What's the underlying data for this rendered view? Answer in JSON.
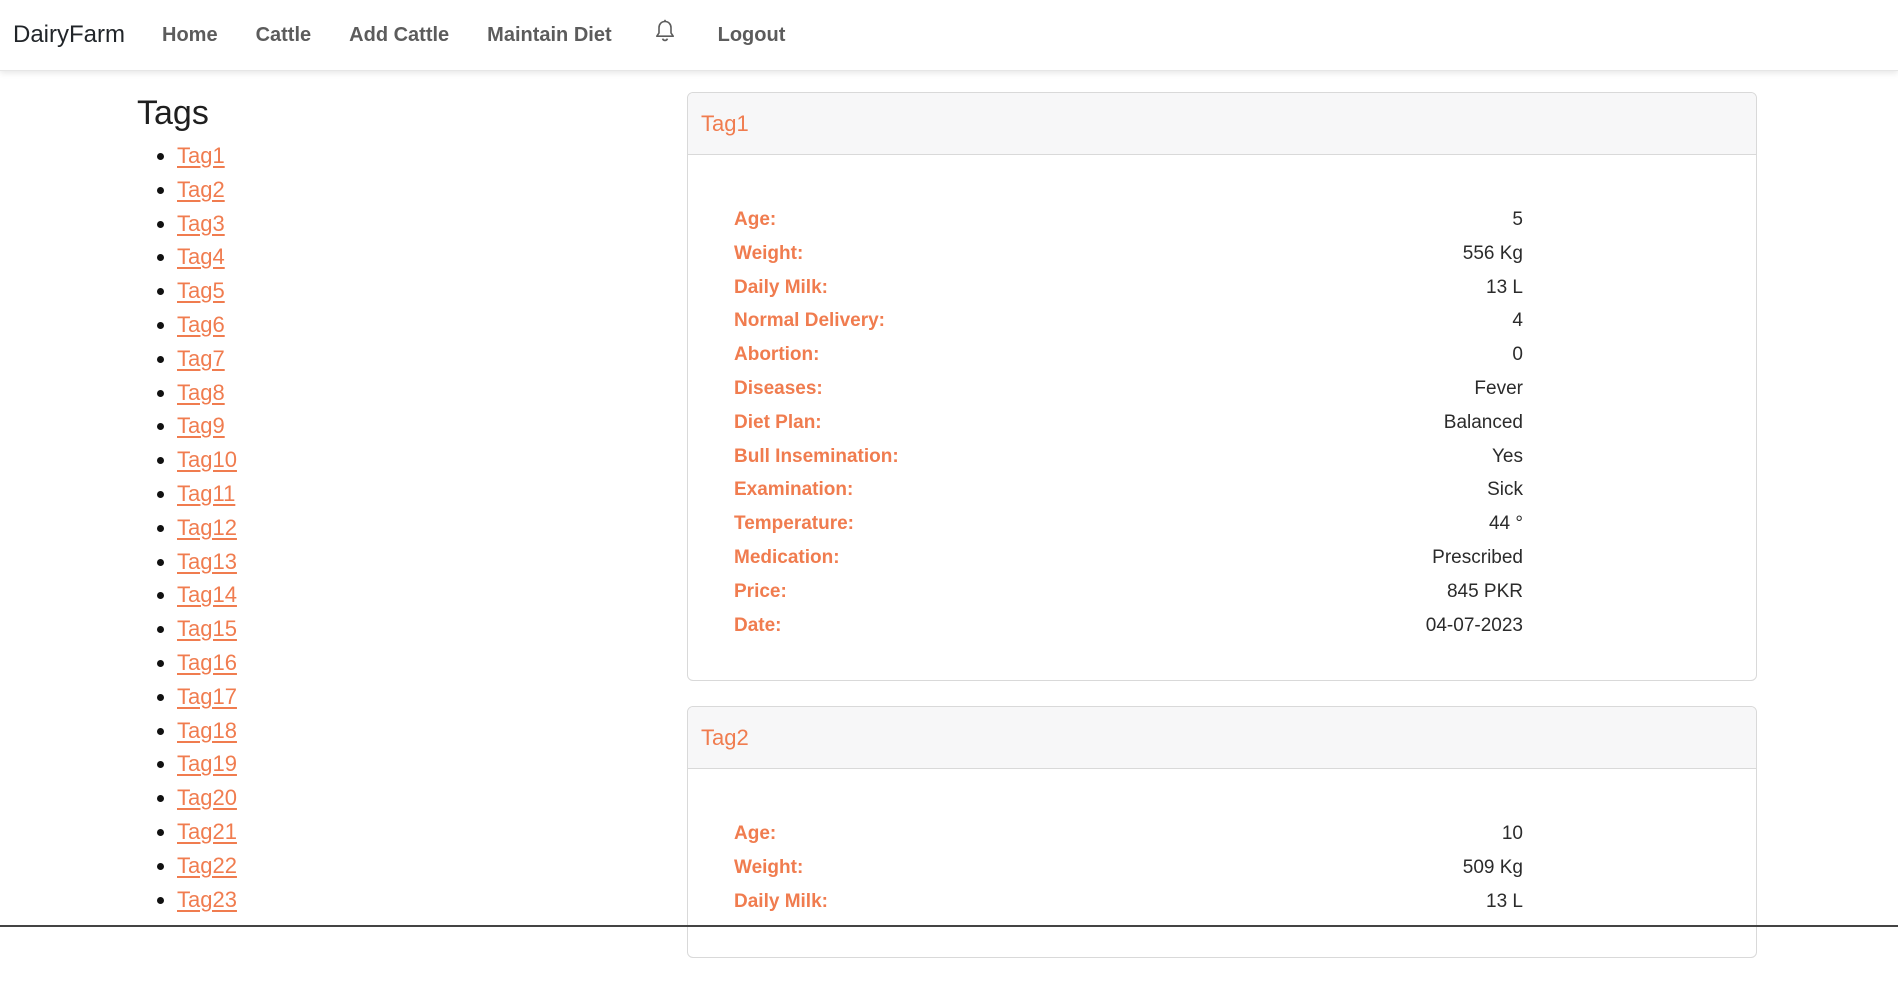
{
  "navbar": {
    "brand": "DairyFarm",
    "links": [
      "Home",
      "Cattle",
      "Add Cattle",
      "Maintain Diet"
    ],
    "logout": "Logout"
  },
  "sidebar": {
    "title": "Tags",
    "tags": [
      "Tag1",
      "Tag2",
      "Tag3",
      "Tag4",
      "Tag5",
      "Tag6",
      "Tag7",
      "Tag8",
      "Tag9",
      "Tag10",
      "Tag11",
      "Tag12",
      "Tag13",
      "Tag14",
      "Tag15",
      "Tag16",
      "Tag17",
      "Tag18",
      "Tag19",
      "Tag20",
      "Tag21",
      "Tag22",
      "Tag23"
    ]
  },
  "cards": [
    {
      "title": "Tag1",
      "fields": [
        {
          "label": "Age:",
          "value": "5"
        },
        {
          "label": "Weight:",
          "value": "556 Kg"
        },
        {
          "label": "Daily Milk:",
          "value": "13 L"
        },
        {
          "label": "Normal Delivery:",
          "value": "4"
        },
        {
          "label": "Abortion:",
          "value": "0"
        },
        {
          "label": "Diseases:",
          "value": "Fever"
        },
        {
          "label": "Diet Plan:",
          "value": "Balanced"
        },
        {
          "label": "Bull Insemination:",
          "value": "Yes"
        },
        {
          "label": "Examination:",
          "value": "Sick"
        },
        {
          "label": "Temperature:",
          "value": "44 °"
        },
        {
          "label": "Medication:",
          "value": "Prescribed"
        },
        {
          "label": "Price:",
          "value": "845 PKR"
        },
        {
          "label": "Date:",
          "value": "04-07-2023"
        }
      ]
    },
    {
      "title": "Tag2",
      "fields": [
        {
          "label": "Age:",
          "value": "10"
        },
        {
          "label": "Weight:",
          "value": "509 Kg"
        },
        {
          "label": "Daily Milk:",
          "value": "13 L"
        }
      ]
    }
  ],
  "colors": {
    "accent": "#f07c4f",
    "nav_text": "#5c5c5c",
    "header_bg": "#f7f7f8"
  },
  "icons": {
    "notifications": "bell-icon"
  }
}
